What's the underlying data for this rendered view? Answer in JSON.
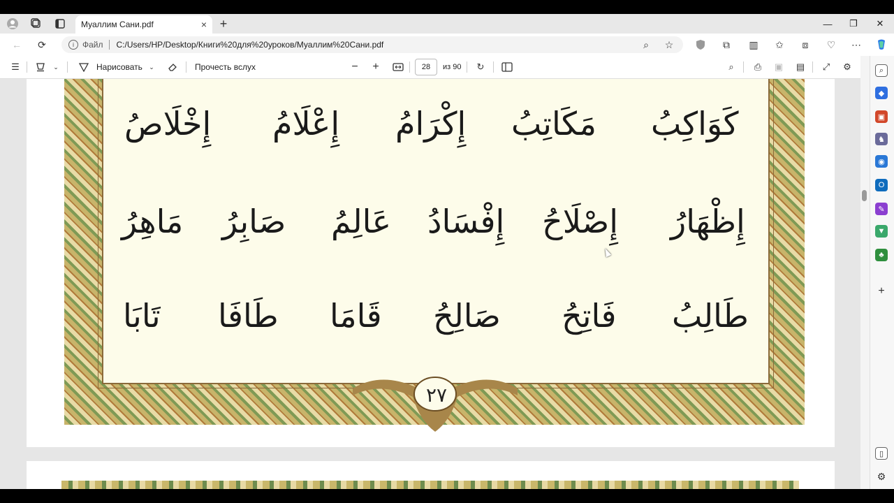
{
  "browser": {
    "tab_title": "Муаллим Сани.pdf",
    "tab_close": "×",
    "new_tab": "+",
    "window_controls": {
      "minimize": "—",
      "maximize": "❐",
      "close": "✕"
    },
    "address": {
      "scheme_label": "Файл",
      "url": "C:/Users/HP/Desktop/Книги%20для%20уроков/Муаллим%20Сани.pdf"
    }
  },
  "pdf_toolbar": {
    "draw_label": "Нарисовать",
    "read_aloud_label": "Прочесть вслух",
    "zoom_out": "−",
    "zoom_in": "+",
    "page_current": "28",
    "page_total": "из 90"
  },
  "page_content": {
    "rows": [
      [
        "كَوَاكِبُ",
        "مَكَاتِبُ",
        "إِكْرَامُ",
        "إِعْلَامُ",
        "إِخْلَاصُ"
      ],
      [
        "إِظْهَارُ",
        "إِصْلَاحُ",
        "إِفْسَادُ",
        "عَالِمُ",
        "صَابِرُ",
        "مَاهِرُ"
      ],
      [
        "طَالِبُ",
        "فَاتِحُ",
        "صَالِحُ",
        "قَامَا",
        "طَافَا",
        "تَابَا"
      ]
    ],
    "page_number": "٢٧"
  },
  "colors": {
    "accent_red": "#c8102e",
    "page_bg": "#fdfcea",
    "border_gold": "#c8b46a",
    "border_green": "#7f9a55"
  }
}
